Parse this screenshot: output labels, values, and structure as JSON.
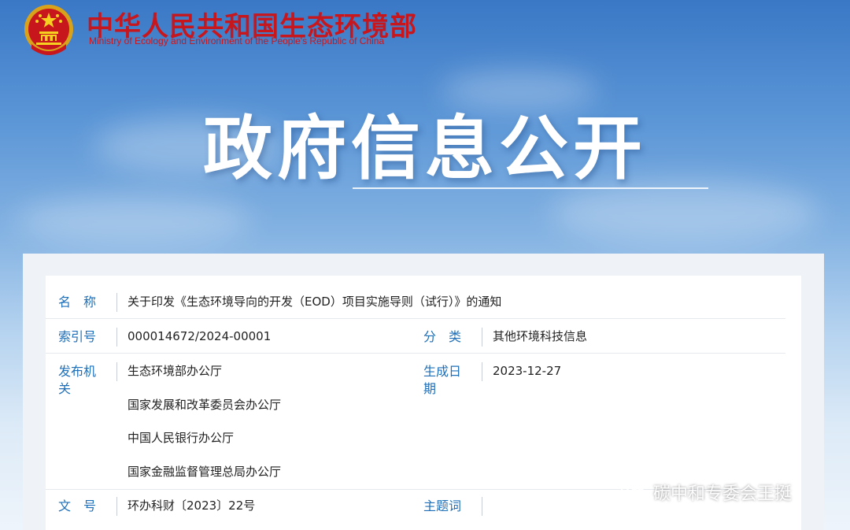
{
  "header": {
    "org_name_cn": "中华人民共和国生态环境部",
    "org_name_en": "Ministry of Ecology and Environment of the People's Republic of China"
  },
  "banner": {
    "title": "政府信息公开"
  },
  "fields": {
    "name": {
      "label": "名　称",
      "value": "关于印发《生态环境导向的开发（EOD）项目实施导则（试行）》的通知"
    },
    "index_no": {
      "label": "索引号",
      "value": "000014672/2024-00001"
    },
    "category": {
      "label": "分　类",
      "value": "其他环境科技信息"
    },
    "issuer": {
      "label": "发布机关",
      "values": [
        "生态环境部办公厅",
        "国家发展和改革委员会办公厅",
        "中国人民银行办公厅",
        "国家金融监督管理总局办公厅"
      ]
    },
    "date": {
      "label": "生成日期",
      "value": "2023-12-27"
    },
    "doc_no": {
      "label": "文　号",
      "value": "环办科财〔2023〕22号"
    },
    "subject": {
      "label": "主题词",
      "value": ""
    }
  },
  "watermark": {
    "text": "碳中和专委会王挺"
  }
}
